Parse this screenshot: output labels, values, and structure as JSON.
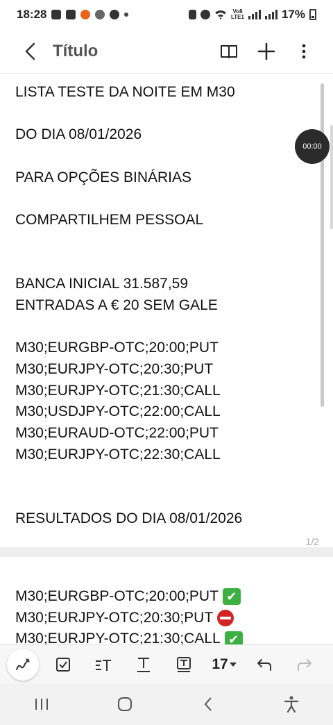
{
  "status_bar": {
    "time": "18:28",
    "network_top": "Vo8",
    "network_bottom": "LTE1",
    "battery": "17%"
  },
  "app_bar": {
    "title": "Título"
  },
  "note": {
    "lines": [
      "LISTA TESTE DA NOITE EM M30",
      "",
      "DO DIA 08/01/2026",
      "",
      "PARA OPÇÕES BINÁRIAS",
      "",
      "COMPARTILHEM PESSOAL",
      "",
      "",
      "BANCA INICIAL 31.587,59",
      "ENTRADAS A € 20 SEM GALE",
      "",
      "M30;EURGBP-OTC;20:00;PUT",
      "M30;EURJPY-OTC;20:30;PUT",
      "M30;EURJPY-OTC;21:30;CALL",
      "M30;USDJPY-OTC;22:00;CALL",
      "M30;EURAUD-OTC;22:00;PUT",
      "M30;EURJPY-OTC;22:30;CALL",
      "",
      "",
      "RESULTADOS DO DIA 08/01/2026"
    ],
    "page_indicator": "1/2",
    "results": [
      {
        "text": "M30;EURGBP-OTC;20:00;PUT",
        "result": "win"
      },
      {
        "text": "M30;EURJPY-OTC;20:30;PUT",
        "result": "loss"
      },
      {
        "text": "M30;EURJPY-OTC;21:30;CALL",
        "result": "win"
      }
    ]
  },
  "recording_timer": "00:00",
  "toolbar": {
    "font_size": "17"
  },
  "icons": {
    "win": "check-mark-button-emoji",
    "loss": "no-entry-emoji"
  },
  "colors": {
    "win": "#3cb043",
    "loss": "#d42323"
  }
}
